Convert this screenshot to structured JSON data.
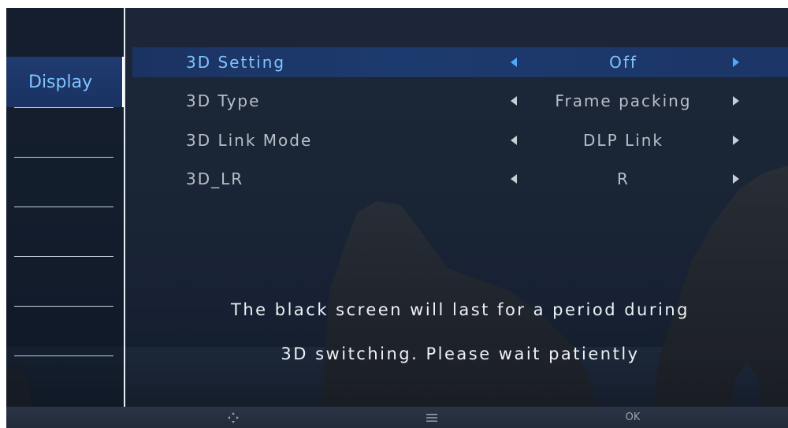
{
  "sidebar": {
    "items": [
      {
        "label": "Display",
        "active": true
      }
    ]
  },
  "menu": {
    "rows": [
      {
        "label": "3D Setting",
        "value": "Off",
        "selected": true
      },
      {
        "label": "3D Type",
        "value": "Frame packing",
        "selected": false
      },
      {
        "label": "3D Link Mode",
        "value": "DLP Link",
        "selected": false
      },
      {
        "label": "3D_LR",
        "value": "R",
        "selected": false
      }
    ]
  },
  "notice": {
    "line1": "The black screen will last for a period during",
    "line2": "3D switching. Please wait patiently"
  },
  "bottom_bar": {
    "nav_icon": "dpad-icon",
    "menu_icon": "menu-icon",
    "ok_label": "OK"
  },
  "colors": {
    "accent_text": "#7ec4ff",
    "arrow_selected": "#4fa8ff",
    "highlight_row": "#1d3a6e",
    "background": "#1a2536"
  }
}
